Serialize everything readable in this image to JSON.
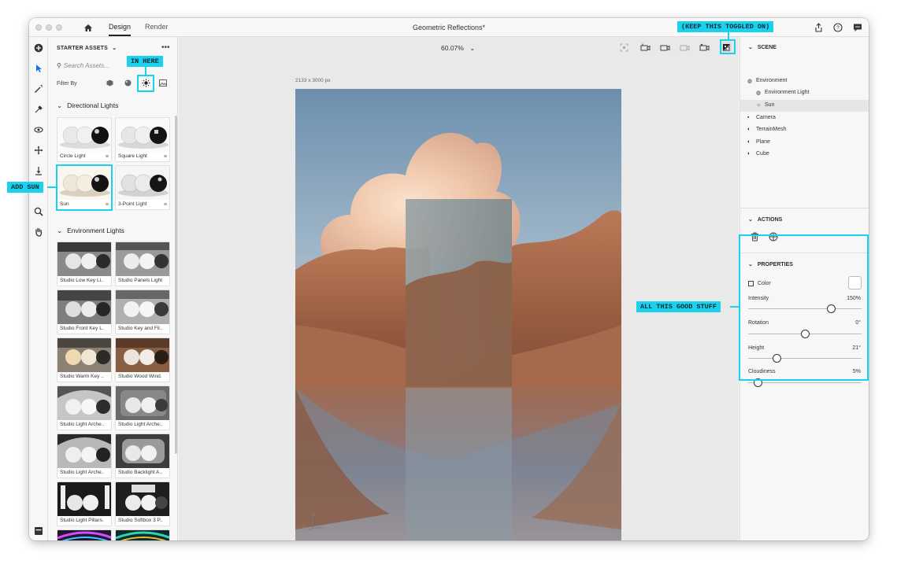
{
  "window": {
    "title": "Geometric Reflections*",
    "tabs": [
      {
        "label": "Design",
        "active": true
      },
      {
        "label": "Render",
        "active": false
      }
    ]
  },
  "assets_panel": {
    "header": "STARTER ASSETS",
    "search_placeholder": "Search Assets...",
    "filter_label": "Filter By",
    "sections": [
      {
        "title": "Directional Lights",
        "tiles": [
          "Circle Light",
          "Square Light",
          "Sun",
          "3-Point Light"
        ]
      },
      {
        "title": "Environment Lights",
        "tiles": [
          "Studio Low Key Li...",
          "Studio Panels Light",
          "Studio Front Key L...",
          "Studio Key and Fil...",
          "Studio Warm Key ...",
          "Studio Wood Wind...",
          "Studio Light Arche...",
          "Studio Light Arche...",
          "Studio Light Arche...",
          "Studio Backlight A...",
          "Studio Light Pillars...",
          "Studio Softbox 3 P..."
        ]
      }
    ]
  },
  "canvas": {
    "zoom": "60.07%",
    "dimensions": "2133 x 3000 px",
    "axis": {
      "y": "Y",
      "z": "Z",
      "x": "X"
    }
  },
  "scene_panel": {
    "title": "SCENE",
    "items": [
      {
        "label": "Environment",
        "icon": "globe-icon",
        "level": 0
      },
      {
        "label": "Environment Light",
        "icon": "globe-icon",
        "level": 1
      },
      {
        "label": "Sun",
        "icon": "sun-icon",
        "level": 1,
        "selected": true
      },
      {
        "label": "Camera",
        "icon": "camera-icon",
        "level": 0
      },
      {
        "label": "TerrainMesh",
        "icon": "mesh-icon",
        "level": 0
      },
      {
        "label": "Plane",
        "icon": "mesh-icon",
        "level": 0
      },
      {
        "label": "Cube",
        "icon": "mesh-icon",
        "level": 0
      }
    ]
  },
  "actions_panel": {
    "title": "ACTIONS"
  },
  "properties_panel": {
    "title": "PROPERTIES",
    "color_label": "Color",
    "properties": [
      {
        "label": "Intensity",
        "value": "150%",
        "fraction": 0.75
      },
      {
        "label": "Rotation",
        "value": "0°",
        "fraction": 0.5
      },
      {
        "label": "Height",
        "value": "21°",
        "fraction": 0.23
      },
      {
        "label": "Cloudiness",
        "value": "5%",
        "fraction": 0.05
      }
    ]
  },
  "callouts": {
    "toggle": "(KEEP THIS TOGGLED ON)",
    "filter": "IN HERE",
    "sun": "ADD SUN",
    "properties": "ALL THIS GOOD STUFF"
  },
  "colors": {
    "callout": "#1ad2ee",
    "selected_row": "#e6e6e6"
  }
}
